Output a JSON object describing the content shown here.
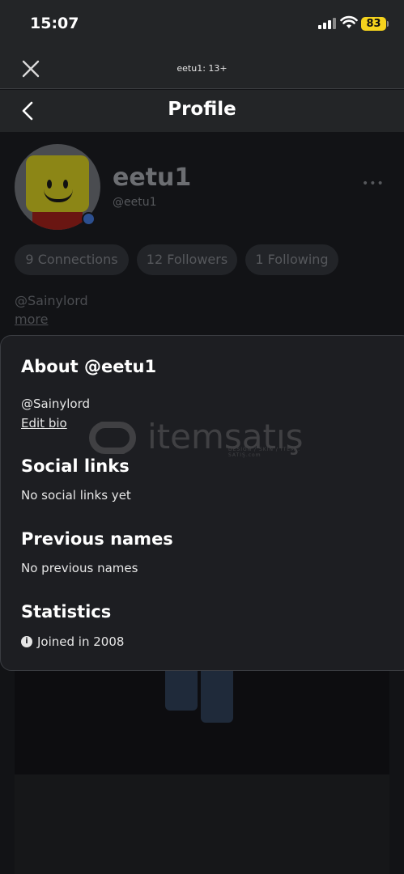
{
  "status_bar": {
    "time": "15:07",
    "battery": "83",
    "battery_color": "#f5d31d"
  },
  "top_bar": {
    "title": "eetu1: 13+",
    "close_icon": "close-icon"
  },
  "header": {
    "title": "Profile",
    "back_icon": "chevron-left-icon"
  },
  "profile": {
    "display_name": "eetu1",
    "username": "@eetu1",
    "more_label": "•••",
    "connections": "9 Connections",
    "followers": "12 Followers",
    "following": "1 Following",
    "bio": "@Sainylord",
    "more_link": "more"
  },
  "about": {
    "title": "About @eetu1",
    "bio": "@Sainylord",
    "edit_bio": "Edit bio",
    "social_links": {
      "title": "Social links",
      "text": "No social links yet"
    },
    "previous_names": {
      "title": "Previous names",
      "text": "No previous names"
    },
    "statistics": {
      "title": "Statistics",
      "joined": "Joined in 2008",
      "info_glyph": "i"
    }
  },
  "watermark": {
    "text": "itemsatış",
    "tagline": "DESIGN / SKIN / ITEM . SATIŞ",
    "domain": ".com"
  }
}
